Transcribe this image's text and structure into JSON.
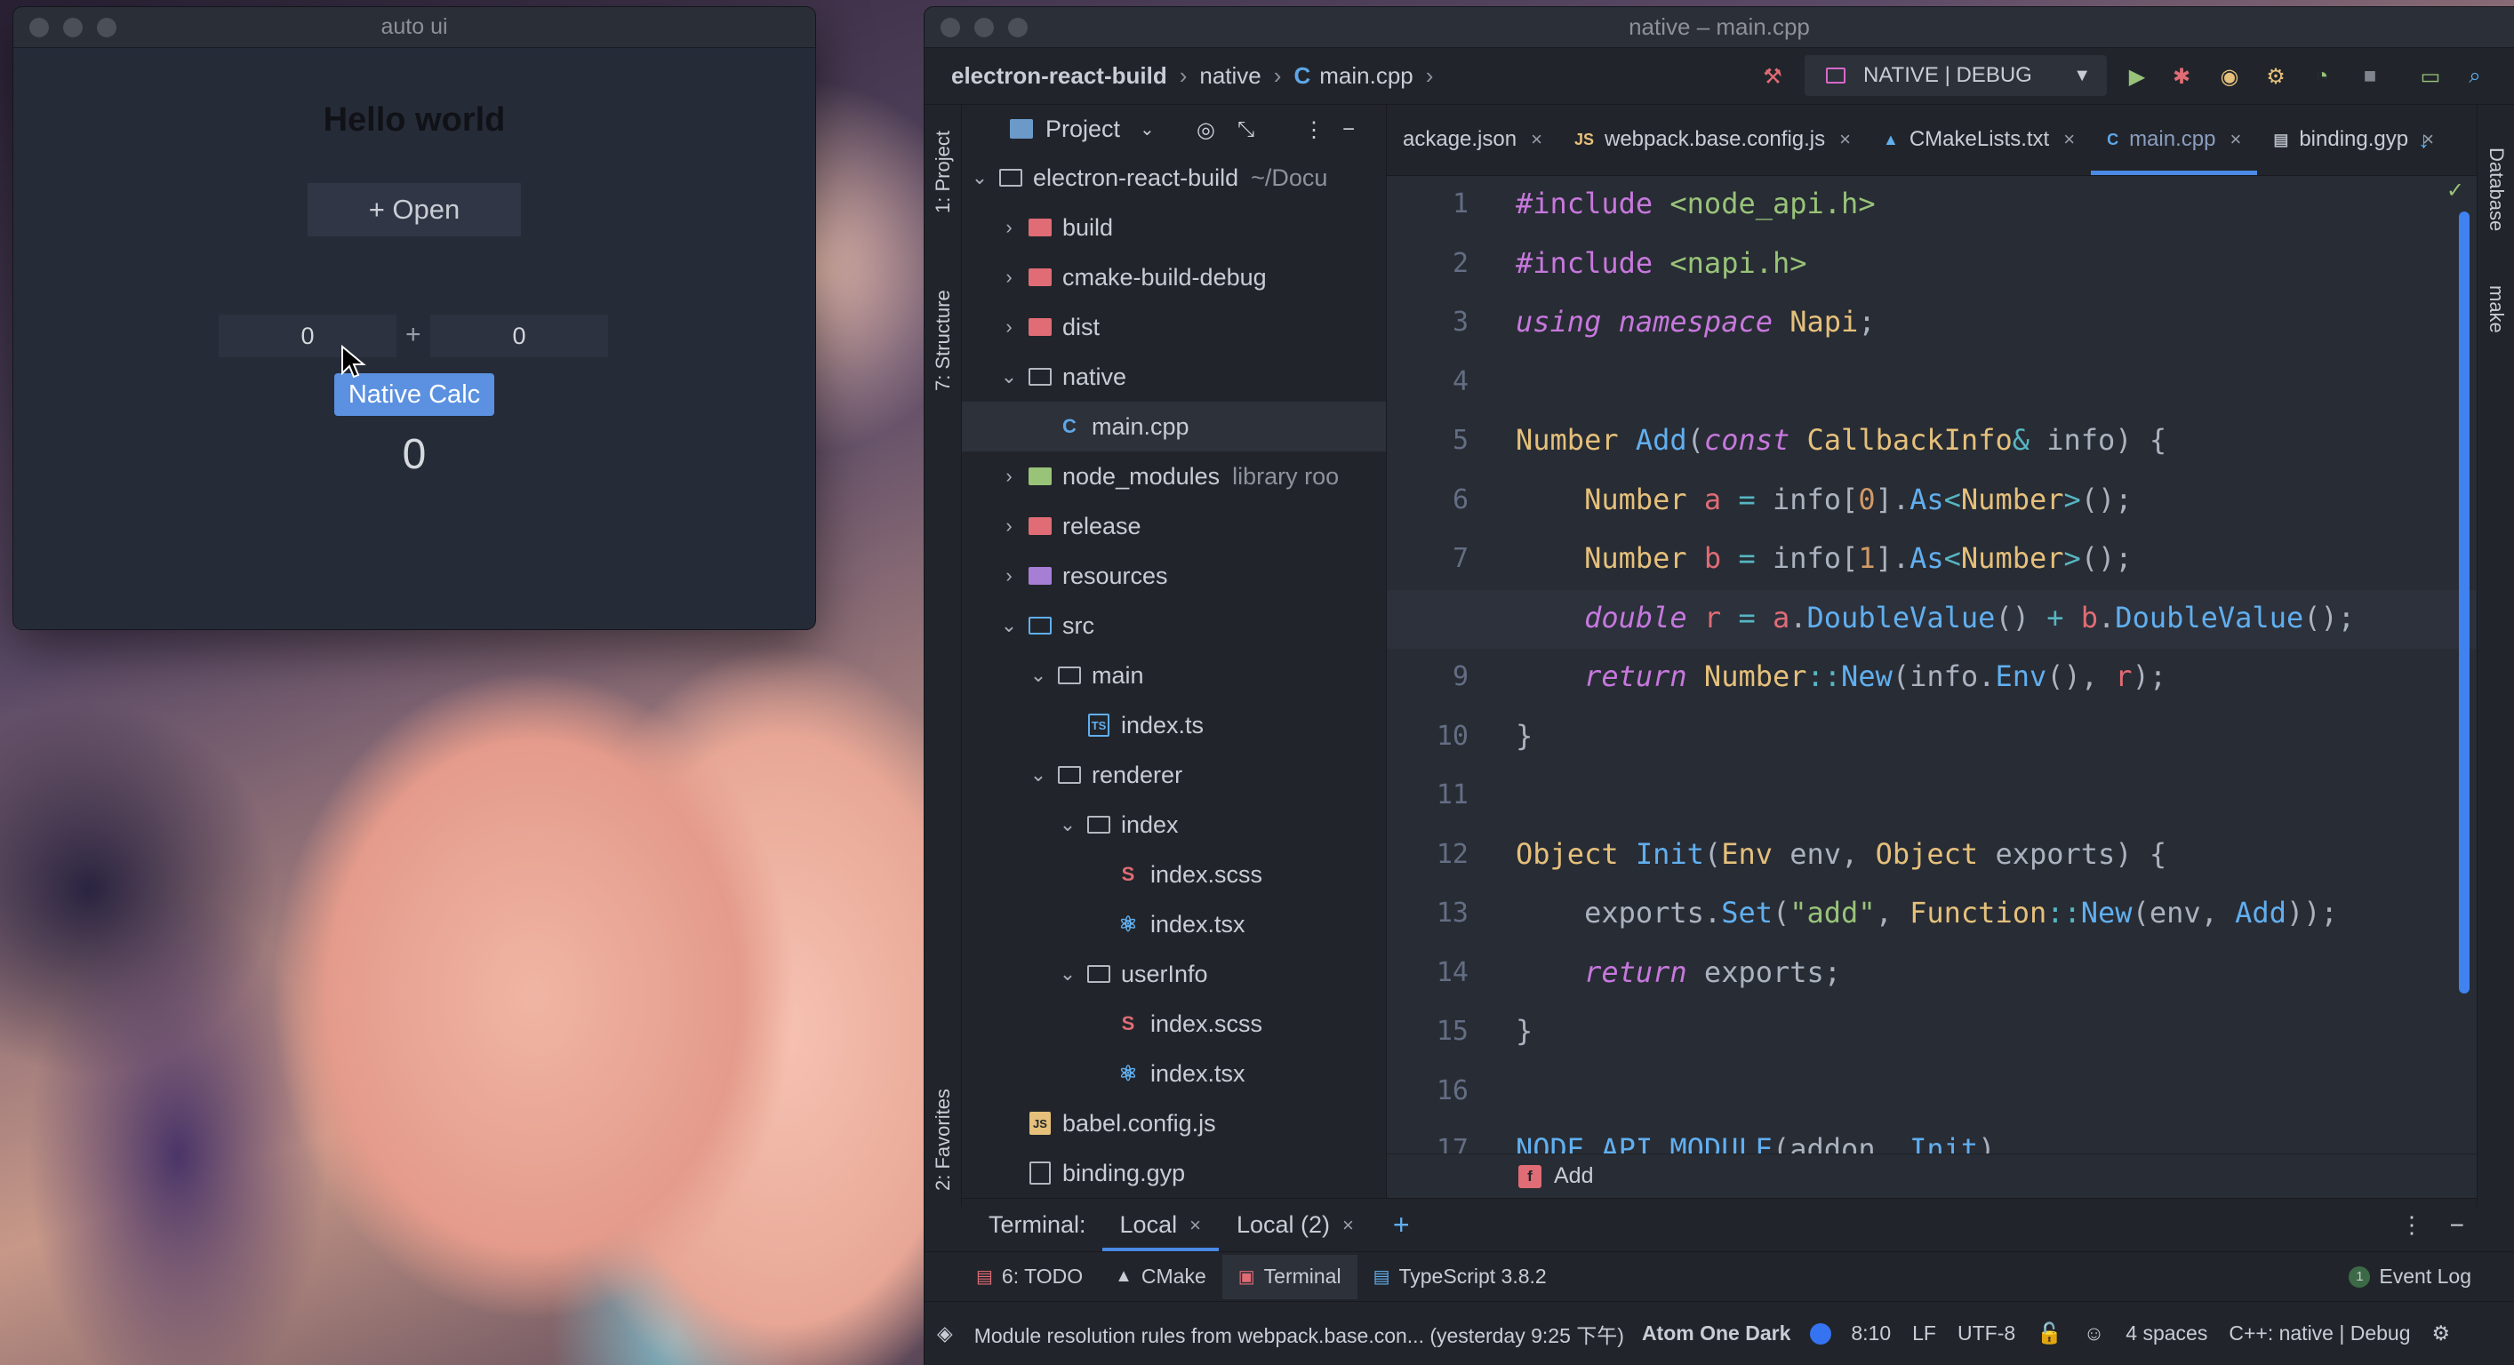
{
  "app_window": {
    "title": "auto ui",
    "heading": "Hello world",
    "open_button": "+ Open",
    "input_a": "0",
    "input_b": "0",
    "plus": "+",
    "calc_button": "Native Calc",
    "result": "0"
  },
  "ide": {
    "title": "native – main.cpp",
    "breadcrumbs": [
      "electron-react-build",
      "native",
      "main.cpp"
    ],
    "run_config": "NATIVE | DEBUG",
    "left_tabs": {
      "project": "1: Project",
      "structure": "7: Structure",
      "favorites": "2: Favorites"
    },
    "right_tabs": {
      "database": "Database",
      "make": "make"
    },
    "project_panel": {
      "title": "Project",
      "tree": [
        {
          "label": "electron-react-build",
          "extra": "~/Docu",
          "indent": 0,
          "chev": "v",
          "icon": "folder-outline"
        },
        {
          "label": "build",
          "indent": 1,
          "chev": ">",
          "icon": "folder-red"
        },
        {
          "label": "cmake-build-debug",
          "indent": 1,
          "chev": ">",
          "icon": "folder-red"
        },
        {
          "label": "dist",
          "indent": 1,
          "chev": ">",
          "icon": "folder-red"
        },
        {
          "label": "native",
          "indent": 1,
          "chev": "v",
          "icon": "folder-outline"
        },
        {
          "label": "main.cpp",
          "indent": 2,
          "chev": "",
          "icon": "cpp",
          "selected": true
        },
        {
          "label": "node_modules",
          "extra": "library roo",
          "indent": 1,
          "chev": ">",
          "icon": "folder-green"
        },
        {
          "label": "release",
          "indent": 1,
          "chev": ">",
          "icon": "folder-red"
        },
        {
          "label": "resources",
          "indent": 1,
          "chev": ">",
          "icon": "folder-purple"
        },
        {
          "label": "src",
          "indent": 1,
          "chev": "v",
          "icon": "folder-blue"
        },
        {
          "label": "main",
          "indent": 2,
          "chev": "v",
          "icon": "folder-outline"
        },
        {
          "label": "index.ts",
          "indent": 3,
          "chev": "",
          "icon": "ts"
        },
        {
          "label": "renderer",
          "indent": 2,
          "chev": "v",
          "icon": "folder-outline"
        },
        {
          "label": "index",
          "indent": 3,
          "chev": "v",
          "icon": "folder-outline"
        },
        {
          "label": "index.scss",
          "indent": 4,
          "chev": "",
          "icon": "scss"
        },
        {
          "label": "index.tsx",
          "indent": 4,
          "chev": "",
          "icon": "react"
        },
        {
          "label": "userInfo",
          "indent": 3,
          "chev": "v",
          "icon": "folder-outline"
        },
        {
          "label": "index.scss",
          "indent": 4,
          "chev": "",
          "icon": "scss"
        },
        {
          "label": "index.tsx",
          "indent": 4,
          "chev": "",
          "icon": "react"
        },
        {
          "label": "babel.config.js",
          "indent": 1,
          "chev": "",
          "icon": "js"
        },
        {
          "label": "binding.gyp",
          "indent": 1,
          "chev": "",
          "icon": "file"
        }
      ]
    },
    "editor_tabs": [
      {
        "label": "ackage.json",
        "icon": "",
        "active": false
      },
      {
        "label": "webpack.base.config.js",
        "icon": "JS",
        "active": false
      },
      {
        "label": "CMakeLists.txt",
        "icon": "▲",
        "active": false
      },
      {
        "label": "main.cpp",
        "icon": "C",
        "active": true
      },
      {
        "label": "binding.gyp",
        "icon": "▤",
        "active": false
      }
    ],
    "code": [
      [
        [
          "k-inc",
          "#include "
        ],
        [
          "k-str",
          "<node_api.h>"
        ]
      ],
      [
        [
          "k-inc",
          "#include "
        ],
        [
          "k-str",
          "<napi.h>"
        ]
      ],
      [
        [
          "k-kw",
          "using namespace "
        ],
        [
          "k-type",
          "Napi"
        ],
        [
          "",
          "; "
        ]
      ],
      [],
      [
        [
          "k-type",
          "Number "
        ],
        [
          "k-fn",
          "Add"
        ],
        [
          "",
          "("
        ],
        [
          "k-kw",
          "const "
        ],
        [
          "k-type",
          "CallbackInfo"
        ],
        [
          "k-op",
          "& "
        ],
        [
          "",
          "info) {"
        ]
      ],
      [
        [
          "",
          "    "
        ],
        [
          "k-type",
          "Number "
        ],
        [
          "k-var",
          "a"
        ],
        [
          "k-op",
          " = "
        ],
        [
          "",
          "info["
        ],
        [
          "k-num",
          "0"
        ],
        [
          "",
          "]."
        ],
        [
          "k-fn",
          "As"
        ],
        [
          "k-op",
          "<"
        ],
        [
          "k-type",
          "Number"
        ],
        [
          "k-op",
          ">"
        ],
        [
          "",
          "();"
        ]
      ],
      [
        [
          "",
          "    "
        ],
        [
          "k-type",
          "Number "
        ],
        [
          "k-var",
          "b"
        ],
        [
          "k-op",
          " = "
        ],
        [
          "",
          "info["
        ],
        [
          "k-num",
          "1"
        ],
        [
          "",
          "]."
        ],
        [
          "k-fn",
          "As"
        ],
        [
          "k-op",
          "<"
        ],
        [
          "k-type",
          "Number"
        ],
        [
          "k-op",
          ">"
        ],
        [
          "",
          "();"
        ]
      ],
      [
        [
          "",
          "    "
        ],
        [
          "k-kw",
          "double "
        ],
        [
          "k-var",
          "r"
        ],
        [
          "k-op",
          " = "
        ],
        [
          "k-var",
          "a"
        ],
        [
          "",
          "."
        ],
        [
          "k-fn",
          "DoubleValue"
        ],
        [
          "",
          "() "
        ],
        [
          "k-op",
          "+ "
        ],
        [
          "k-var",
          "b"
        ],
        [
          "",
          "."
        ],
        [
          "k-fn",
          "DoubleValue"
        ],
        [
          "",
          "();"
        ]
      ],
      [
        [
          "",
          "    "
        ],
        [
          "k-kw",
          "return "
        ],
        [
          "k-type",
          "Number"
        ],
        [
          "k-op",
          "::"
        ],
        [
          "k-fn",
          "New"
        ],
        [
          "",
          "(info."
        ],
        [
          "k-fn",
          "Env"
        ],
        [
          "",
          "(), "
        ],
        [
          "k-var",
          "r"
        ],
        [
          "",
          ");"
        ]
      ],
      [
        [
          "",
          "}"
        ]
      ],
      [],
      [
        [
          "k-type",
          "Object "
        ],
        [
          "k-fn",
          "Init"
        ],
        [
          "",
          "("
        ],
        [
          "k-type",
          "Env "
        ],
        [
          "",
          "env, "
        ],
        [
          "k-type",
          "Object "
        ],
        [
          "",
          "exports) {"
        ]
      ],
      [
        [
          "",
          "    exports."
        ],
        [
          "k-fn",
          "Set"
        ],
        [
          "",
          "("
        ],
        [
          "k-str",
          "\"add\""
        ],
        [
          "",
          ", "
        ],
        [
          "k-type",
          "Function"
        ],
        [
          "k-op",
          "::"
        ],
        [
          "k-fn",
          "New"
        ],
        [
          "",
          "(env, "
        ],
        [
          "k-fn",
          "Add"
        ],
        [
          "",
          "));"
        ]
      ],
      [
        [
          "",
          "    "
        ],
        [
          "k-kw",
          "return "
        ],
        [
          "",
          "exports;"
        ]
      ],
      [
        [
          "",
          "}"
        ]
      ],
      [],
      [
        [
          "k-fn",
          "NODE_API_MODULE"
        ],
        [
          "",
          "(addon, "
        ],
        [
          "k-fn",
          "Init"
        ],
        [
          "",
          ")"
        ]
      ]
    ],
    "current_line": 8,
    "bottom_breadcrumb": {
      "badge": "f",
      "label": "Add"
    },
    "terminal": {
      "label": "Terminal:",
      "tabs": [
        "Local",
        "Local (2)"
      ],
      "add": "+"
    },
    "tool_windows": [
      {
        "label": "6: TODO",
        "icon": "▤",
        "active": false
      },
      {
        "label": "CMake",
        "icon": "▲",
        "active": false
      },
      {
        "label": "Terminal",
        "icon": "▣",
        "active": true
      },
      {
        "label": "TypeScript 3.8.2",
        "icon": "▤",
        "active": false
      }
    ],
    "event_log": {
      "badge": "1",
      "label": "Event Log"
    },
    "status": {
      "message": "Module resolution rules from webpack.base.con... (yesterday 9:25 下午)",
      "theme": "Atom One Dark",
      "position": "8:10",
      "line_sep": "LF",
      "encoding": "UTF-8",
      "indent": "4 spaces",
      "context": "C++: native | Debug"
    },
    "colors": {
      "accent": "#4a8ae6",
      "background": "#282c34"
    }
  }
}
